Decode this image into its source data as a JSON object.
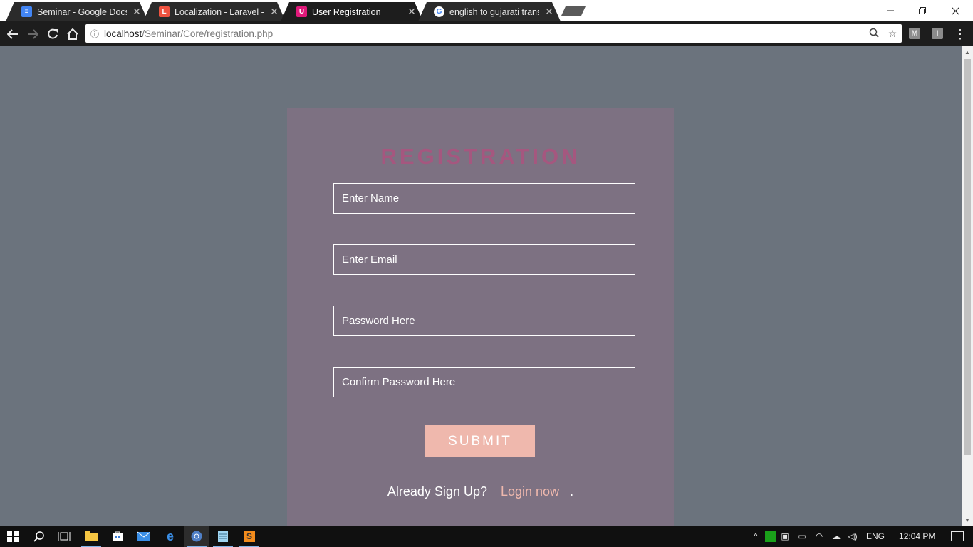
{
  "browser": {
    "tabs": [
      {
        "title": "Seminar - Google Docs",
        "favicon": "docs-icon",
        "color": "#4285f4"
      },
      {
        "title": "Localization - Laravel - Tl",
        "favicon": "laravel-icon",
        "color": "#f05340"
      },
      {
        "title": "User Registration",
        "favicon": "app-icon",
        "color": "#e0197a",
        "active": true
      },
      {
        "title": "english to gujarati transla",
        "favicon": "google-icon",
        "color": "#ffffff"
      }
    ],
    "tab_close_glyph": "✕",
    "address": {
      "host": "localhost",
      "path": "/Seminar/Core/registration.php"
    },
    "extensions": [
      "M",
      "I"
    ]
  },
  "form": {
    "title": "REGISTRATION",
    "name_placeholder": "Enter Name",
    "email_placeholder": "Enter Email",
    "password_placeholder": "Password Here",
    "confirm_placeholder": "Confirm Password Here",
    "submit_label": "SUBMIT",
    "already_text": "Already Sign Up?",
    "login_link": "Login now",
    "trailing": "."
  },
  "taskbar": {
    "language": "ENG",
    "time": "12:04 PM"
  },
  "colors": {
    "page_bg": "#6b737d",
    "card_bg": "#7d7182",
    "title": "#a5577f",
    "accent": "#efb8ad"
  }
}
